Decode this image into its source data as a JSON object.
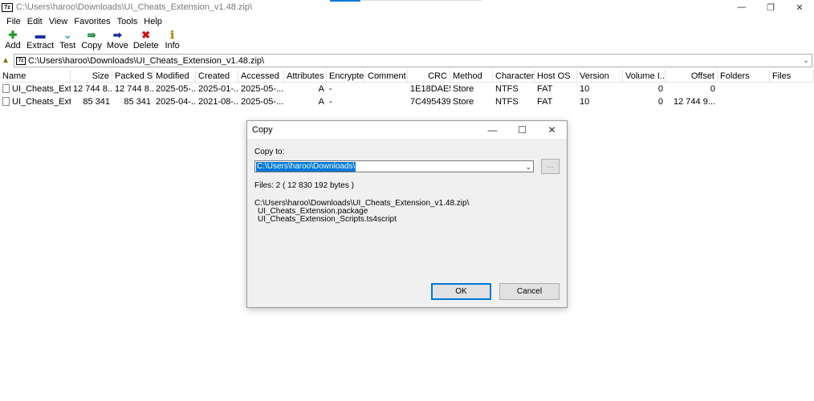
{
  "window": {
    "app_icon": "7z",
    "title": "C:\\Users\\haroo\\Downloads\\UI_Cheats_Extension_v1.48.zip\\",
    "controls": [
      "minimize-icon",
      "restore-icon",
      "close-icon"
    ]
  },
  "menu": {
    "items": [
      "File",
      "Edit",
      "View",
      "Favorites",
      "Tools",
      "Help"
    ]
  },
  "toolbar": {
    "buttons": [
      {
        "label": "Add",
        "icon": "add-icon",
        "glyph": "✚",
        "color": "#1a9a1a"
      },
      {
        "label": "Extract",
        "icon": "extract-icon",
        "glyph": "▬",
        "color": "#1a2f9a"
      },
      {
        "label": "Test",
        "icon": "test-icon",
        "glyph": "⌄",
        "color": "#3aa7c9"
      },
      {
        "label": "Copy",
        "icon": "copy-icon",
        "glyph": "⇛",
        "color": "#1a8a3a"
      },
      {
        "label": "Move",
        "icon": "move-icon",
        "glyph": "➡",
        "color": "#1a2f9a"
      },
      {
        "label": "Delete",
        "icon": "delete-icon",
        "glyph": "✖",
        "color": "#d01010"
      },
      {
        "label": "Info",
        "icon": "info-icon",
        "glyph": "ℹ",
        "color": "#b08a00"
      }
    ]
  },
  "address": {
    "path": "C:\\Users\\haroo\\Downloads\\UI_Cheats_Extension_v1.48.zip\\"
  },
  "table": {
    "columns": [
      "Name",
      "Size",
      "Packed Si...",
      "Modified",
      "Created",
      "Accessed",
      "Attributes",
      "Encrypted",
      "Comment",
      "CRC",
      "Method",
      "Character...",
      "Host OS",
      "Version",
      "Volume I...",
      "Offset",
      "Folders",
      "Files"
    ],
    "rows": [
      [
        "UI_Cheats_Exte...",
        "12 744 8...",
        "12 744 8...",
        "2025-05-...",
        "2025-01-...",
        "2025-05-...",
        "A",
        "-",
        "",
        "1E18DAE5",
        "Store",
        "NTFS",
        "FAT",
        "10",
        "0",
        "0",
        "",
        ""
      ],
      [
        "UI_Cheats_Exte...",
        "85 341",
        "85 341",
        "2025-04-...",
        "2021-08-...",
        "2025-05-...",
        "A",
        "-",
        "",
        "7C495439",
        "Store",
        "NTFS",
        "FAT",
        "10",
        "0",
        "12 744 9...",
        "",
        ""
      ]
    ]
  },
  "dialog": {
    "title": "Copy",
    "copy_to_label": "Copy to:",
    "copy_to_value": "C:\\Users\\haroo\\Downloads\\",
    "browse_label": "...",
    "files_summary": "Files: 2    ( 12 830 192 bytes )",
    "source_path": "C:\\Users\\haroo\\Downloads\\UI_Cheats_Extension_v1.48.zip\\",
    "files": [
      "UI_Cheats_Extension.package",
      "UI_Cheats_Extension_Scripts.ts4script"
    ],
    "ok_label": "OK",
    "cancel_label": "Cancel"
  }
}
